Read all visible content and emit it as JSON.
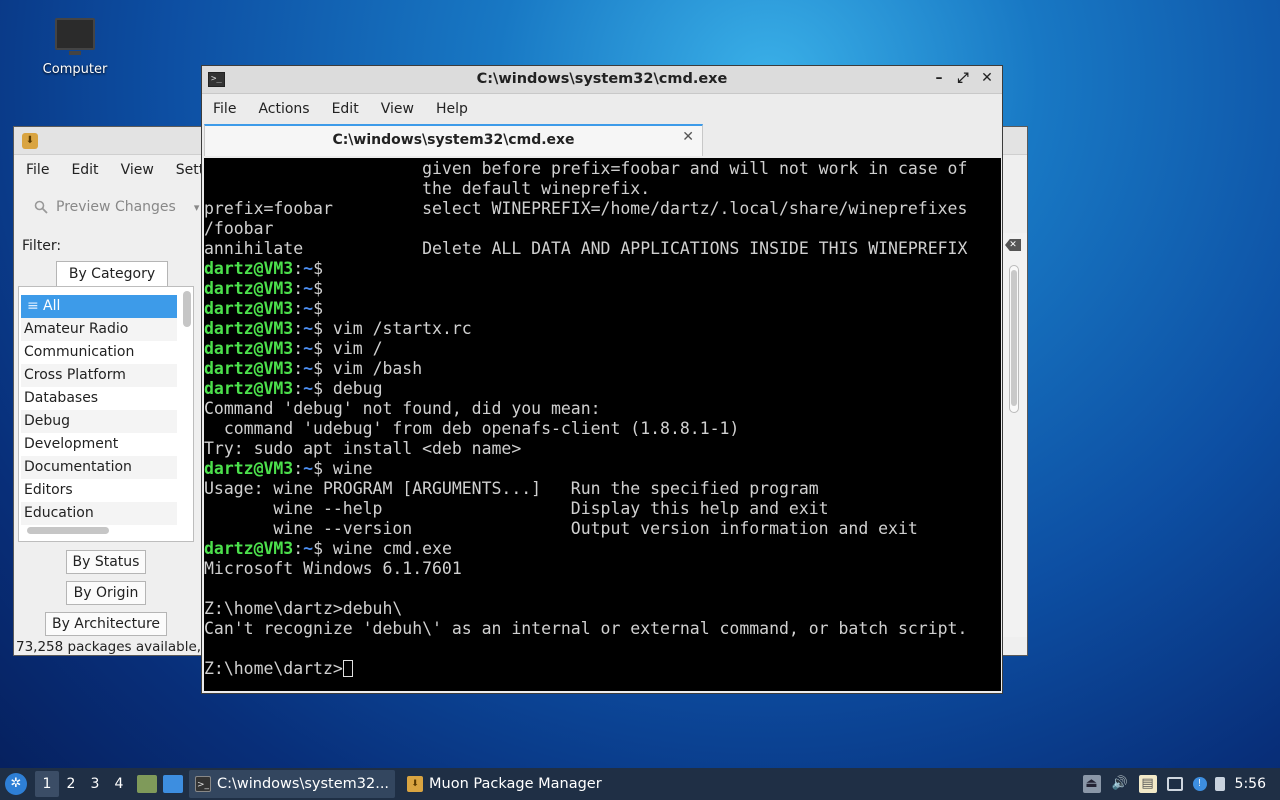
{
  "desktop": {
    "icon_label": "Computer"
  },
  "muon": {
    "menu": [
      "File",
      "Edit",
      "View",
      "Sett"
    ],
    "preview_label": "Preview Changes",
    "filter_label": "Filter:",
    "tab_category": "By Category",
    "categories": [
      "All",
      "Amateur Radio",
      "Communication",
      "Cross Platform",
      "Databases",
      "Debug",
      "Development",
      "Documentation",
      "Editors",
      "Education"
    ],
    "tab_status": "By Status",
    "tab_origin": "By Origin",
    "tab_arch": "By Architecture",
    "status_text": "73,258 packages available,"
  },
  "terminal": {
    "window_title": "C:\\windows\\system32\\cmd.exe",
    "menu": [
      "File",
      "Actions",
      "Edit",
      "View",
      "Help"
    ],
    "tab_title": "C:\\windows\\system32\\cmd.exe",
    "lines": [
      {
        "text": "                      given before prefix=foobar and will not work in case of"
      },
      {
        "text": "                      the default wineprefix."
      },
      {
        "text": "prefix=foobar         select WINEPREFIX=/home/dartz/.local/share/wineprefixes"
      },
      {
        "text": "/foobar"
      },
      {
        "text": "annihilate            Delete ALL DATA AND APPLICATIONS INSIDE THIS WINEPREFIX"
      },
      {
        "prompt": true,
        "text": ""
      },
      {
        "prompt": true,
        "text": ""
      },
      {
        "prompt": true,
        "text": ""
      },
      {
        "prompt": true,
        "text": " vim /startx.rc"
      },
      {
        "prompt": true,
        "text": " vim /"
      },
      {
        "prompt": true,
        "text": " vim /bash"
      },
      {
        "prompt": true,
        "text": " debug"
      },
      {
        "text": "Command 'debug' not found, did you mean:"
      },
      {
        "text": "  command 'udebug' from deb openafs-client (1.8.8.1-1)"
      },
      {
        "text": "Try: sudo apt install <deb name>"
      },
      {
        "prompt": true,
        "text": " wine"
      },
      {
        "text": "Usage: wine PROGRAM [ARGUMENTS...]   Run the specified program"
      },
      {
        "text": "       wine --help                   Display this help and exit"
      },
      {
        "text": "       wine --version                Output version information and exit"
      },
      {
        "prompt": true,
        "text": " wine cmd.exe"
      },
      {
        "text": "Microsoft Windows 6.1.7601"
      },
      {
        "text": ""
      },
      {
        "text": "Z:\\home\\dartz>debuh\\"
      },
      {
        "text": "Can't recognize 'debuh\\' as an internal or external command, or batch script."
      },
      {
        "text": ""
      },
      {
        "text": "Z:\\home\\dartz>",
        "cursor": true
      }
    ],
    "prompt_user": "dartz@VM3",
    "prompt_sep": ":",
    "prompt_path": "~",
    "prompt_dollar": "$"
  },
  "taskbar": {
    "workspaces": [
      "1",
      "2",
      "3",
      "4"
    ],
    "tasks": [
      {
        "label": "C:\\windows\\system32...",
        "active": true
      },
      {
        "label": "Muon Package Manager",
        "active": false
      }
    ],
    "clock": "5:56"
  }
}
